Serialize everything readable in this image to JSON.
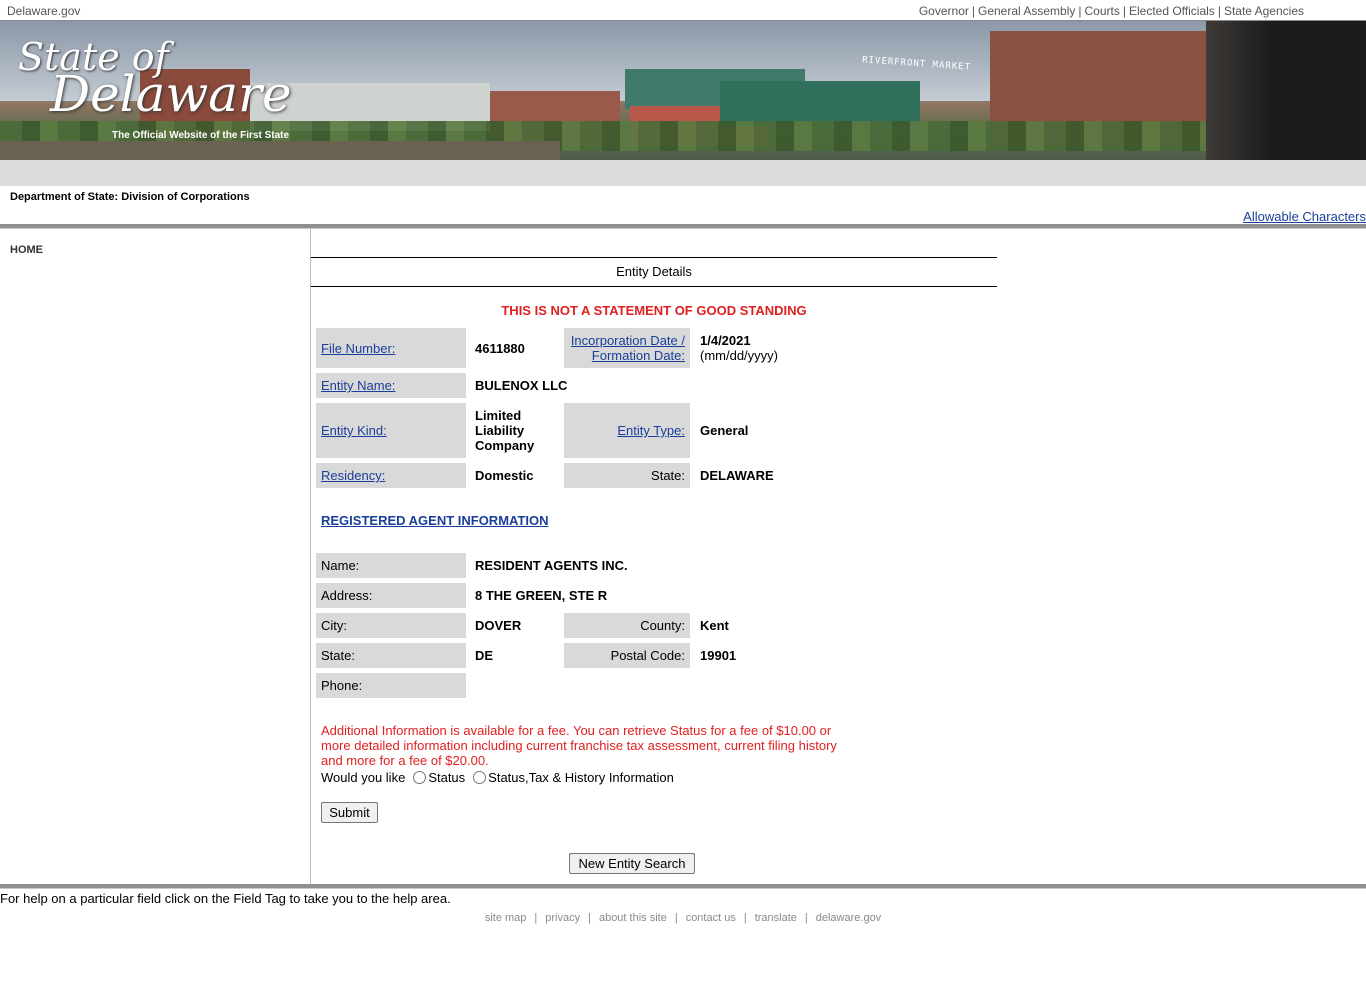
{
  "topbar": {
    "site": "Delaware.gov",
    "links": [
      "Governor",
      "General Assembly",
      "Courts",
      "Elected Officials",
      "State Agencies"
    ],
    "separator": "|"
  },
  "banner": {
    "logo_line1": "State of",
    "logo_line2": "Delaware",
    "tagline": "The Official Website of the First State",
    "sign_text": "RIVERFRONT MARKET"
  },
  "header": {
    "department": "Department of State: Division of Corporations",
    "allowable_link": "Allowable Characters"
  },
  "nav": {
    "home": "HOME"
  },
  "main": {
    "title": "Entity Details",
    "warning": "THIS IS NOT A STATEMENT OF GOOD STANDING",
    "entity": {
      "file_number_label": "File Number:",
      "file_number": "4611880",
      "incorporation_label_1": "Incorporation Date /",
      "incorporation_label_2": "Formation Date:",
      "incorporation_date": "1/4/2021",
      "date_format": "(mm/dd/yyyy)",
      "entity_name_label": "Entity Name:",
      "entity_name": "BULENOX LLC",
      "entity_kind_label": "Entity Kind:",
      "entity_kind_1": "Limited",
      "entity_kind_2": "Liability",
      "entity_kind_3": "Company",
      "entity_type_label": "Entity Type:",
      "entity_type": "General",
      "residency_label": "Residency:",
      "residency": "Domestic",
      "state_label": "State:",
      "state": "DELAWARE"
    },
    "registered_agent": {
      "title": "REGISTERED AGENT INFORMATION",
      "name_label": "Name:",
      "name": "RESIDENT AGENTS INC.",
      "address_label": "Address:",
      "address": "8 THE GREEN, STE R",
      "city_label": "City:",
      "city": "DOVER",
      "county_label": "County:",
      "county": "Kent",
      "state_label": "State:",
      "state": "DE",
      "postal_label": "Postal Code:",
      "postal": "19901",
      "phone_label": "Phone:",
      "phone": ""
    },
    "fee_text": "Additional Information is available for a fee. You can retrieve Status for a fee of $10.00 or more detailed information including current franchise tax assessment, current filing history and more for a fee of $20.00.",
    "would_you_like": "Would you like",
    "option_status": "Status",
    "option_full": "Status,Tax & History Information",
    "submit_label": "Submit",
    "new_search_label": "New Entity Search"
  },
  "help_text": "For help on a particular field click on the Field Tag to take you to the help area.",
  "footer": {
    "links": [
      "site map",
      "privacy",
      "about this site",
      "contact us",
      "translate",
      "delaware.gov"
    ],
    "separator": "|"
  }
}
